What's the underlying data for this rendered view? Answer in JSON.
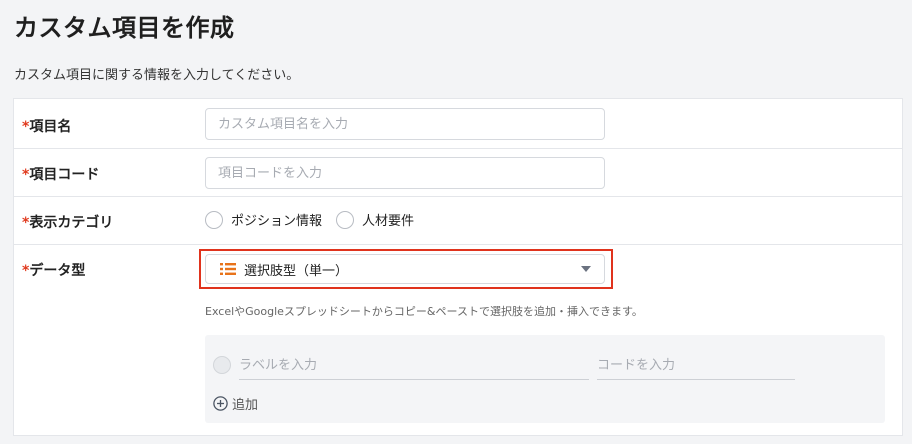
{
  "page": {
    "title": "カスタム項目を作成",
    "subtitle": "カスタム項目に関する情報を入力してください。"
  },
  "form": {
    "required_mark": "*",
    "item_name": {
      "label": "項目名",
      "value": "",
      "placeholder": "カスタム項目名を入力"
    },
    "item_code": {
      "label": "項目コード",
      "value": "",
      "placeholder": "項目コードを入力"
    },
    "display_category": {
      "label": "表示カテゴリ",
      "options": [
        {
          "label": "ポジション情報",
          "selected": false
        },
        {
          "label": "人材要件",
          "selected": false
        }
      ]
    },
    "data_type": {
      "label": "データ型",
      "selected_value": "選択肢型（単一）",
      "icon": "list-icon",
      "hint": "ExcelやGoogleスプレッドシートからコピー&ペーストで選択肢を追加・挿入できます。",
      "highlighted": true,
      "highlight_color": "#e0331d"
    },
    "choices": {
      "label_placeholder": "ラベルを入力",
      "code_placeholder": "コードを入力",
      "add_label": "追加"
    }
  },
  "colors": {
    "required": "#e03a1e",
    "list_icon": "#e8731a",
    "background": "#f3f4f6"
  }
}
